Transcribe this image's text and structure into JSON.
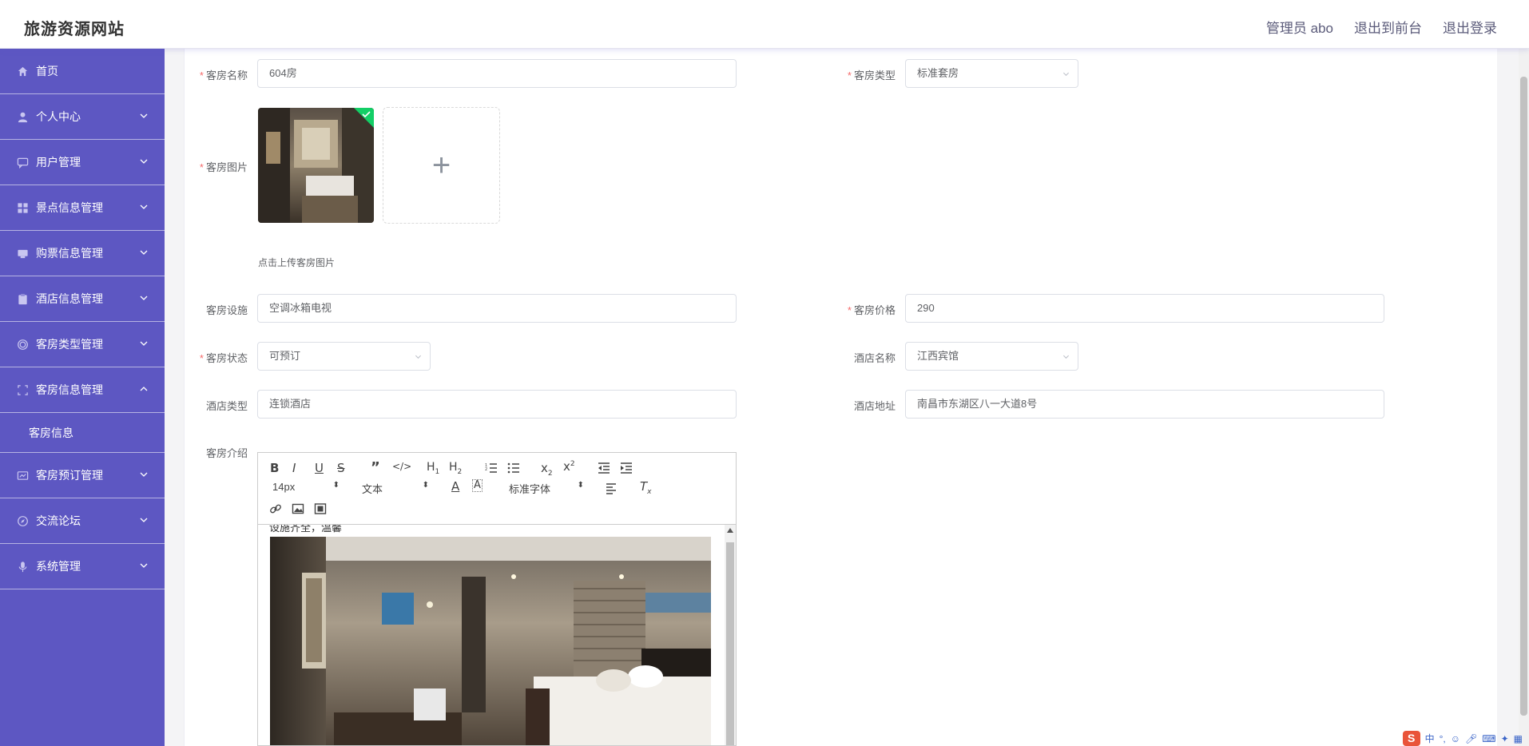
{
  "header": {
    "title": "旅游资源网站",
    "admin_label": "管理员 abo",
    "to_front_label": "退出到前台",
    "logout_label": "退出登录"
  },
  "sidebar": {
    "items": [
      {
        "label": "首页",
        "icon": "home-icon"
      },
      {
        "label": "个人中心",
        "icon": "user-icon"
      },
      {
        "label": "用户管理",
        "icon": "chat-icon"
      },
      {
        "label": "景点信息管理",
        "icon": "grid-icon"
      },
      {
        "label": "购票信息管理",
        "icon": "ticket-icon"
      },
      {
        "label": "酒店信息管理",
        "icon": "clipboard-icon"
      },
      {
        "label": "客房类型管理",
        "icon": "circle-icon"
      },
      {
        "label": "客房信息管理",
        "icon": "frame-icon",
        "expanded": true
      },
      {
        "label": "客房信息"
      },
      {
        "label": "客房预订管理",
        "icon": "card-icon"
      },
      {
        "label": "交流论坛",
        "icon": "compass-icon"
      },
      {
        "label": "系统管理",
        "icon": "mic-icon"
      }
    ]
  },
  "form": {
    "room_name_label": "客房名称",
    "room_name_value": "604房",
    "room_type_label": "客房类型",
    "room_type_value": "标准套房",
    "room_image_label": "客房图片",
    "upload_tip": "点击上传客房图片",
    "facilities_label": "客房设施",
    "facilities_value": "空调冰箱电视",
    "price_label": "客房价格",
    "price_value": "290",
    "status_label": "客房状态",
    "status_value": "可预订",
    "hotel_name_label": "酒店名称",
    "hotel_name_value": "江西宾馆",
    "hotel_type_label": "酒店类型",
    "hotel_type_value": "连锁酒店",
    "hotel_address_label": "酒店地址",
    "hotel_address_value": "南昌市东湖区八一大道8号",
    "intro_label": "客房介绍"
  },
  "editor": {
    "font_size": "14px",
    "block_format": "文本",
    "font_family": "标准字体",
    "content_text": "设施齐全，温馨"
  },
  "tray": {
    "ime_label": "中"
  },
  "colors": {
    "sidebar_bg": "#5d57c2",
    "required": "#f56c6c",
    "upload_success": "#13ce66"
  }
}
